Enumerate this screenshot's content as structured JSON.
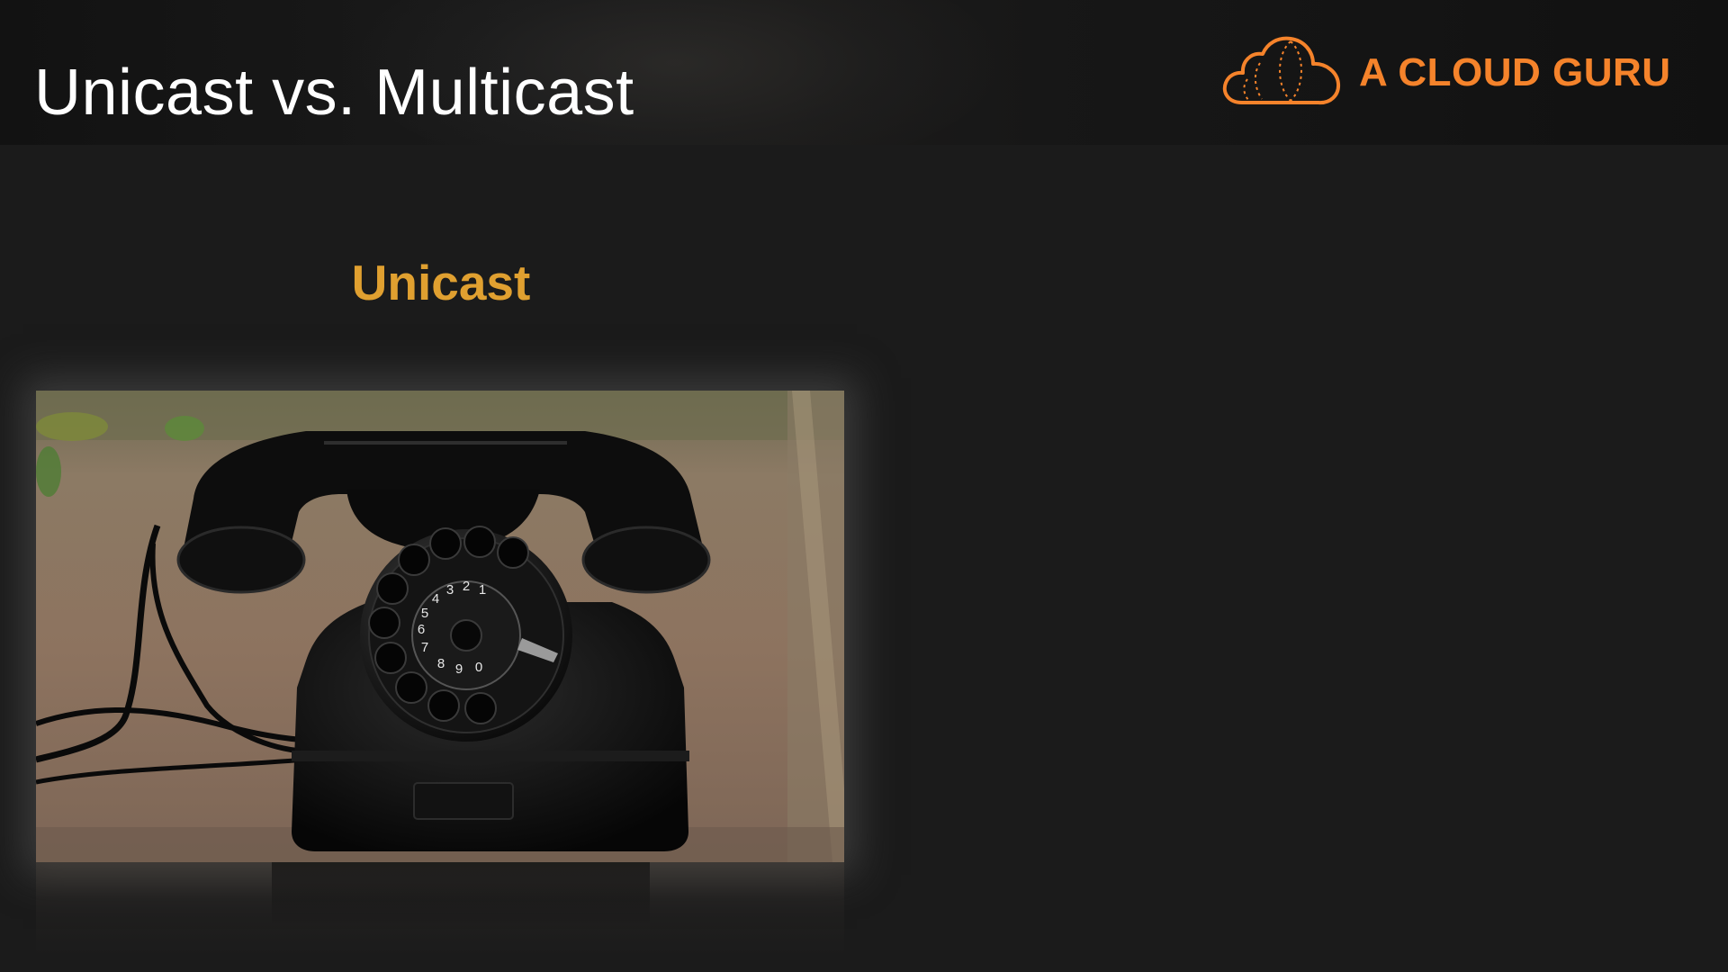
{
  "slide": {
    "title": "Unicast vs. Multicast",
    "subtitle": "Unicast"
  },
  "brand": {
    "name": "A CLOUD GURU",
    "color": "#f5832b",
    "icon": "cloud-logo-icon"
  },
  "image": {
    "subject": "rotary-telephone-icon",
    "dial_digits": [
      "1",
      "2",
      "3",
      "4",
      "5",
      "6",
      "7",
      "8",
      "9",
      "0"
    ]
  },
  "colors": {
    "background": "#1b1b1b",
    "title": "#ffffff",
    "subtitle": "#e0a030",
    "accent": "#f5832b"
  }
}
